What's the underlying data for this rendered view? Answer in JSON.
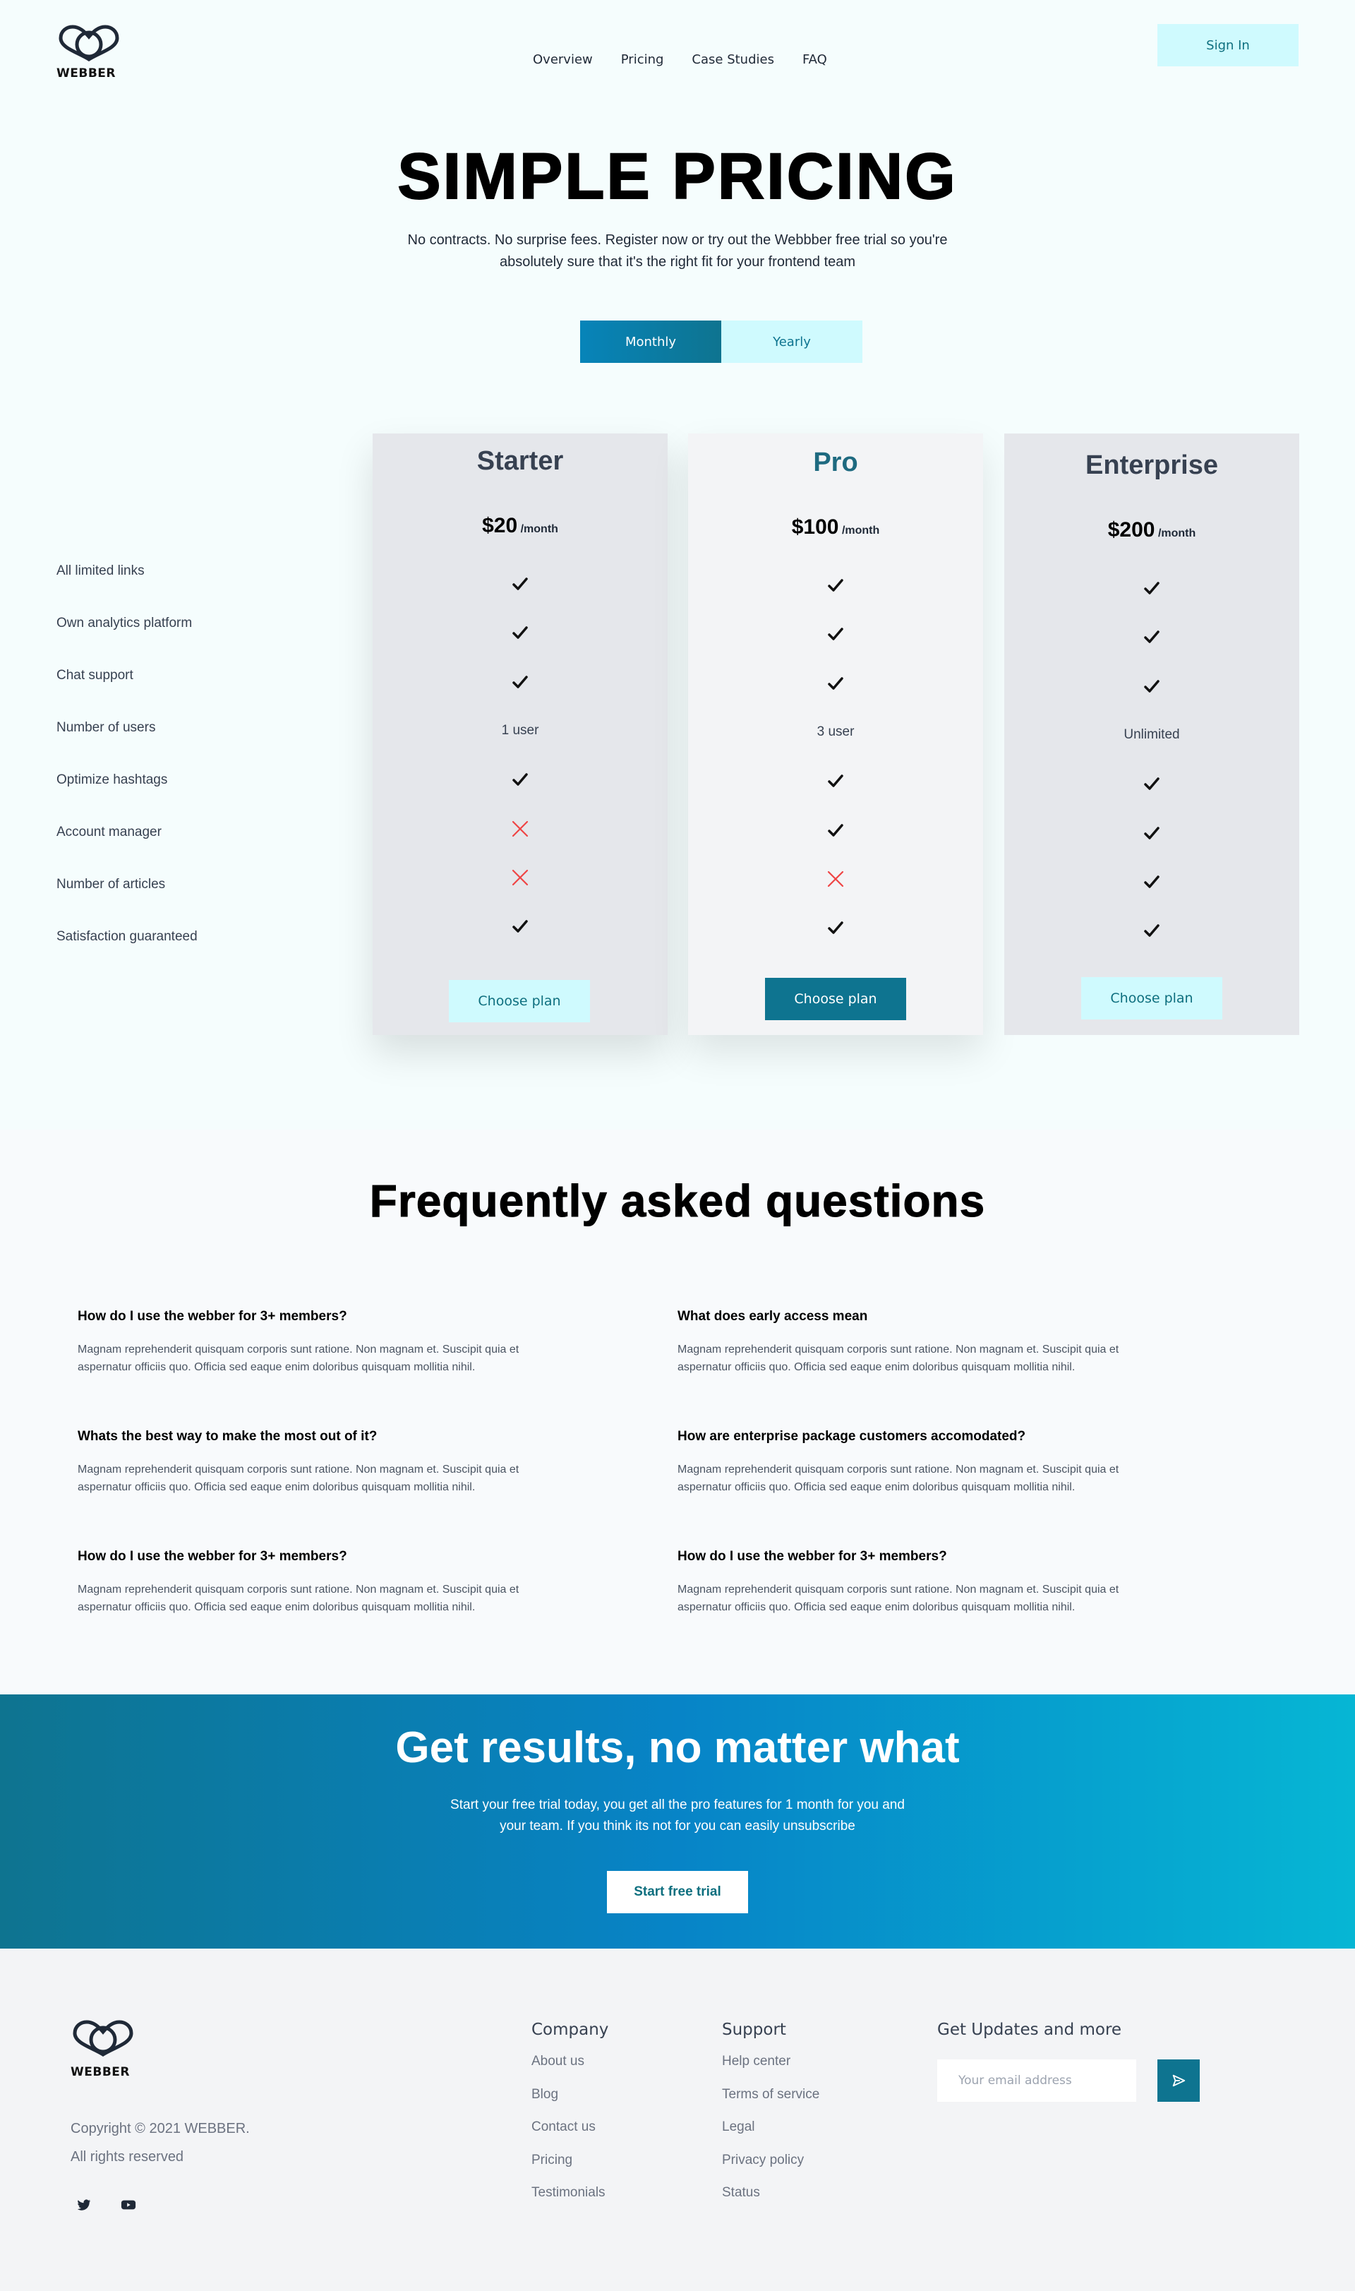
{
  "header": {
    "brand": "WEBBER",
    "nav": [
      "Overview",
      "Pricing",
      "Case Studies",
      "FAQ"
    ],
    "sign_in": "Sign In"
  },
  "hero": {
    "title": "SIMPLE PRICING",
    "subtitle": "No contracts. No surprise fees. Register now or try out the Webbber free trial so you're absolutely sure that it's the right fit for your frontend team",
    "toggle": {
      "monthly": "Monthly",
      "yearly": "Yearly",
      "selected": "Monthly"
    }
  },
  "pricing": {
    "features": [
      "All limited links",
      "Own analytics platform",
      "Chat support",
      "Number of users",
      "Optimize hashtags",
      "Account manager",
      "Number of articles",
      "Satisfaction guaranteed"
    ],
    "per_label": "/month",
    "choose_label": "Choose plan",
    "plans": [
      {
        "name": "Starter",
        "price": "$20",
        "users": "1 user",
        "values": [
          "check",
          "check",
          "check",
          "text",
          "check",
          "cross",
          "cross",
          "check"
        ]
      },
      {
        "name": "Pro",
        "price": "$100",
        "users": "3 user",
        "values": [
          "check",
          "check",
          "check",
          "text",
          "check",
          "check",
          "cross",
          "check"
        ]
      },
      {
        "name": "Enterprise",
        "price": "$200",
        "users": "Unlimited",
        "values": [
          "check",
          "check",
          "check",
          "text",
          "check",
          "check",
          "check",
          "check"
        ]
      }
    ]
  },
  "faq": {
    "title": "Frequently asked questions",
    "items": [
      {
        "q": "How do I use the webber for 3+ members?",
        "a": "Magnam reprehenderit quisquam corporis sunt ratione. Non magnam et. Suscipit quia et aspernatur officiis quo. Officia sed eaque enim doloribus quisquam mollitia nihil."
      },
      {
        "q": "What does early access mean",
        "a": "Magnam reprehenderit quisquam corporis sunt ratione. Non magnam et. Suscipit quia et aspernatur officiis quo. Officia sed eaque enim doloribus quisquam mollitia nihil."
      },
      {
        "q": "Whats the best way to make the most out of it?",
        "a": "Magnam reprehenderit quisquam corporis sunt ratione. Non magnam et. Suscipit quia et aspernatur officiis quo. Officia sed eaque enim doloribus quisquam mollitia nihil."
      },
      {
        "q": "How are enterprise package customers accomodated?",
        "a": "Magnam reprehenderit quisquam corporis sunt ratione. Non magnam et. Suscipit quia et aspernatur officiis quo. Officia sed eaque enim doloribus quisquam mollitia nihil."
      },
      {
        "q": "How do I use the webber for 3+ members?",
        "a": "Magnam reprehenderit quisquam corporis sunt ratione. Non magnam et. Suscipit quia et aspernatur officiis quo. Officia sed eaque enim doloribus quisquam mollitia nihil."
      },
      {
        "q": "How do I use the webber for 3+ members?",
        "a": "Magnam reprehenderit quisquam corporis sunt ratione. Non magnam et. Suscipit quia et aspernatur officiis quo. Officia sed eaque enim doloribus quisquam mollitia nihil."
      }
    ]
  },
  "cta": {
    "title": "Get results, no matter what",
    "subtitle": "Start your free trial today, you get all the pro features for 1 month for you and your team. If you think its not for you can easily unsubscribe",
    "button": "Start free trial"
  },
  "footer": {
    "brand": "WEBBER",
    "copyright": "Copyright © 2021 WEBBER.",
    "rights": "All rights reserved",
    "social_icons": [
      "twitter-icon",
      "youtube-icon"
    ],
    "company": {
      "title": "Company",
      "links": [
        "About us",
        "Blog",
        "Contact us",
        "Pricing",
        "Testimonials"
      ]
    },
    "support": {
      "title": "Support",
      "links": [
        "Help center",
        "Terms of service",
        "Legal",
        "Privacy policy",
        "Status"
      ]
    },
    "newsletter": {
      "title": "Get Updates and more",
      "placeholder": "Your email address"
    }
  },
  "colors": {
    "accent": "#0e7490",
    "accent_light": "#cffafe",
    "check": "#111111",
    "cross": "#ef4444"
  }
}
